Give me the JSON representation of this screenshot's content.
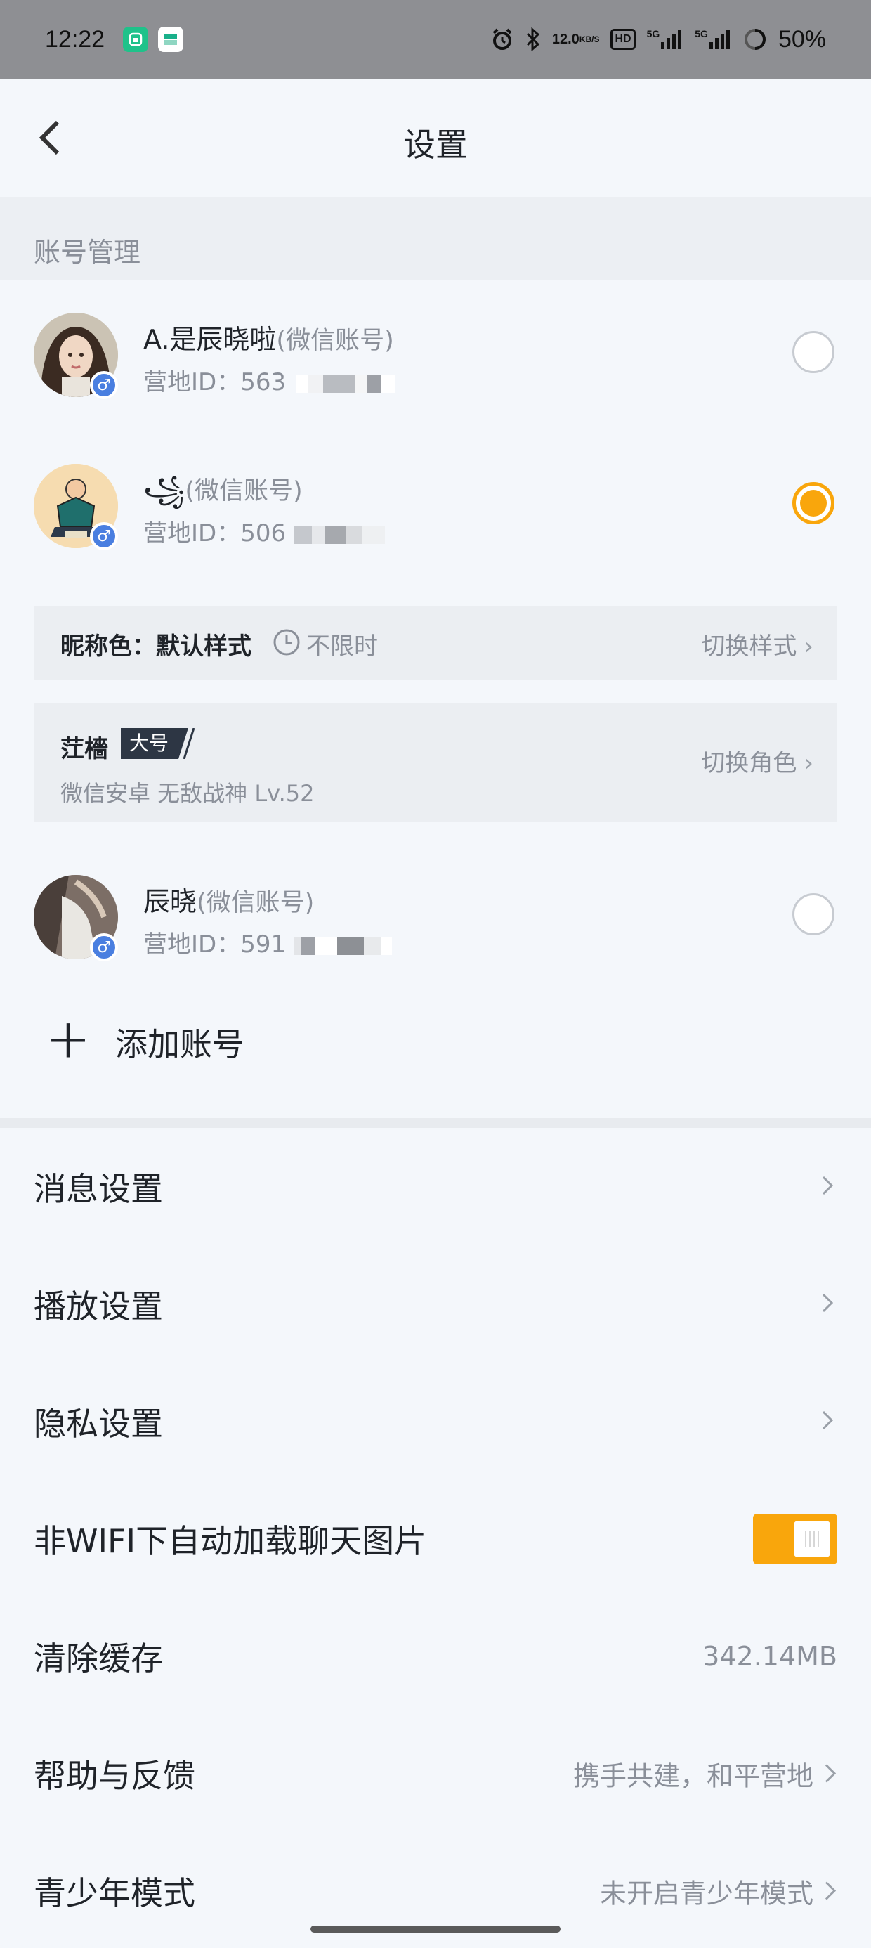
{
  "status_bar": {
    "time": "12:22",
    "net_speed_top": "12.0",
    "net_speed_unit": "KB/S",
    "hd_label": "HD",
    "signal1_label": "5G",
    "signal2_label": "5G",
    "battery": "50%"
  },
  "header": {
    "title": "设置"
  },
  "account_section": {
    "label": "账号管理",
    "accounts": [
      {
        "name": "A.是辰晓啦",
        "tag": "(微信账号)",
        "id_label": "营地ID：",
        "id_visible": "563",
        "selected": false
      },
      {
        "name": "꧁",
        "tag": "(微信账号)",
        "id_label": "营地ID：",
        "id_visible": "506",
        "selected": true
      },
      {
        "name": "辰晓",
        "tag": "(微信账号)",
        "id_label": "营地ID：",
        "id_visible": "591",
        "selected": false
      }
    ],
    "nick_color": {
      "label": "昵称色：",
      "value": "默认样式",
      "duration": "不限时",
      "link": "切换样式"
    },
    "role": {
      "name": "茳檣",
      "tag": "大号",
      "meta": "微信安卓  无敌战神  Lv.52",
      "link": "切换角色"
    },
    "add_account": "添加账号"
  },
  "settings": [
    {
      "label": "消息设置",
      "kind": "nav"
    },
    {
      "label": "播放设置",
      "kind": "nav"
    },
    {
      "label": "隐私设置",
      "kind": "nav"
    },
    {
      "label": "非WIFI下自动加载聊天图片",
      "kind": "toggle",
      "on": true
    },
    {
      "label": "清除缓存",
      "kind": "value",
      "value": "342.14MB"
    },
    {
      "label": "帮助与反馈",
      "kind": "nav",
      "value": "携手共建，和平营地"
    },
    {
      "label": "青少年模式",
      "kind": "nav",
      "value": "未开启青少年模式"
    }
  ],
  "colors": {
    "accent": "#f9a60c",
    "badge_male": "#4a7fe0",
    "text_primary": "#1f2329",
    "text_muted": "#8a8f99"
  }
}
